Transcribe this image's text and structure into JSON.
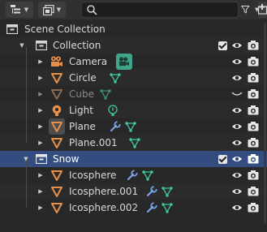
{
  "toolbar": {
    "display_mode_icon": "outliner-display-icon",
    "filter_icon": "view-layer-icon",
    "search": {
      "value": "",
      "placeholder": ""
    },
    "filter_funnel_icon": "funnel-icon",
    "new_collection_icon": "new-collection-icon"
  },
  "tree": {
    "scene_collection": {
      "label": "Scene Collection"
    },
    "collection": {
      "label": "Collection"
    },
    "camera": {
      "label": "Camera"
    },
    "circle": {
      "label": "Circle"
    },
    "cube": {
      "label": "Cube"
    },
    "light": {
      "label": "Light"
    },
    "plane": {
      "label": "Plane"
    },
    "plane001": {
      "label": "Plane.001"
    },
    "snow": {
      "label": "Snow"
    },
    "icosphere": {
      "label": "Icosphere"
    },
    "icosphere001": {
      "label": "Icosphere.001"
    },
    "icosphere002": {
      "label": "Icosphere.002"
    }
  },
  "colors": {
    "background": "#282828",
    "selected_row": "#334d80",
    "mesh_orange": "#e8904a",
    "data_green": "#3fc7a0",
    "modifier_blue": "#7aa3e5"
  }
}
